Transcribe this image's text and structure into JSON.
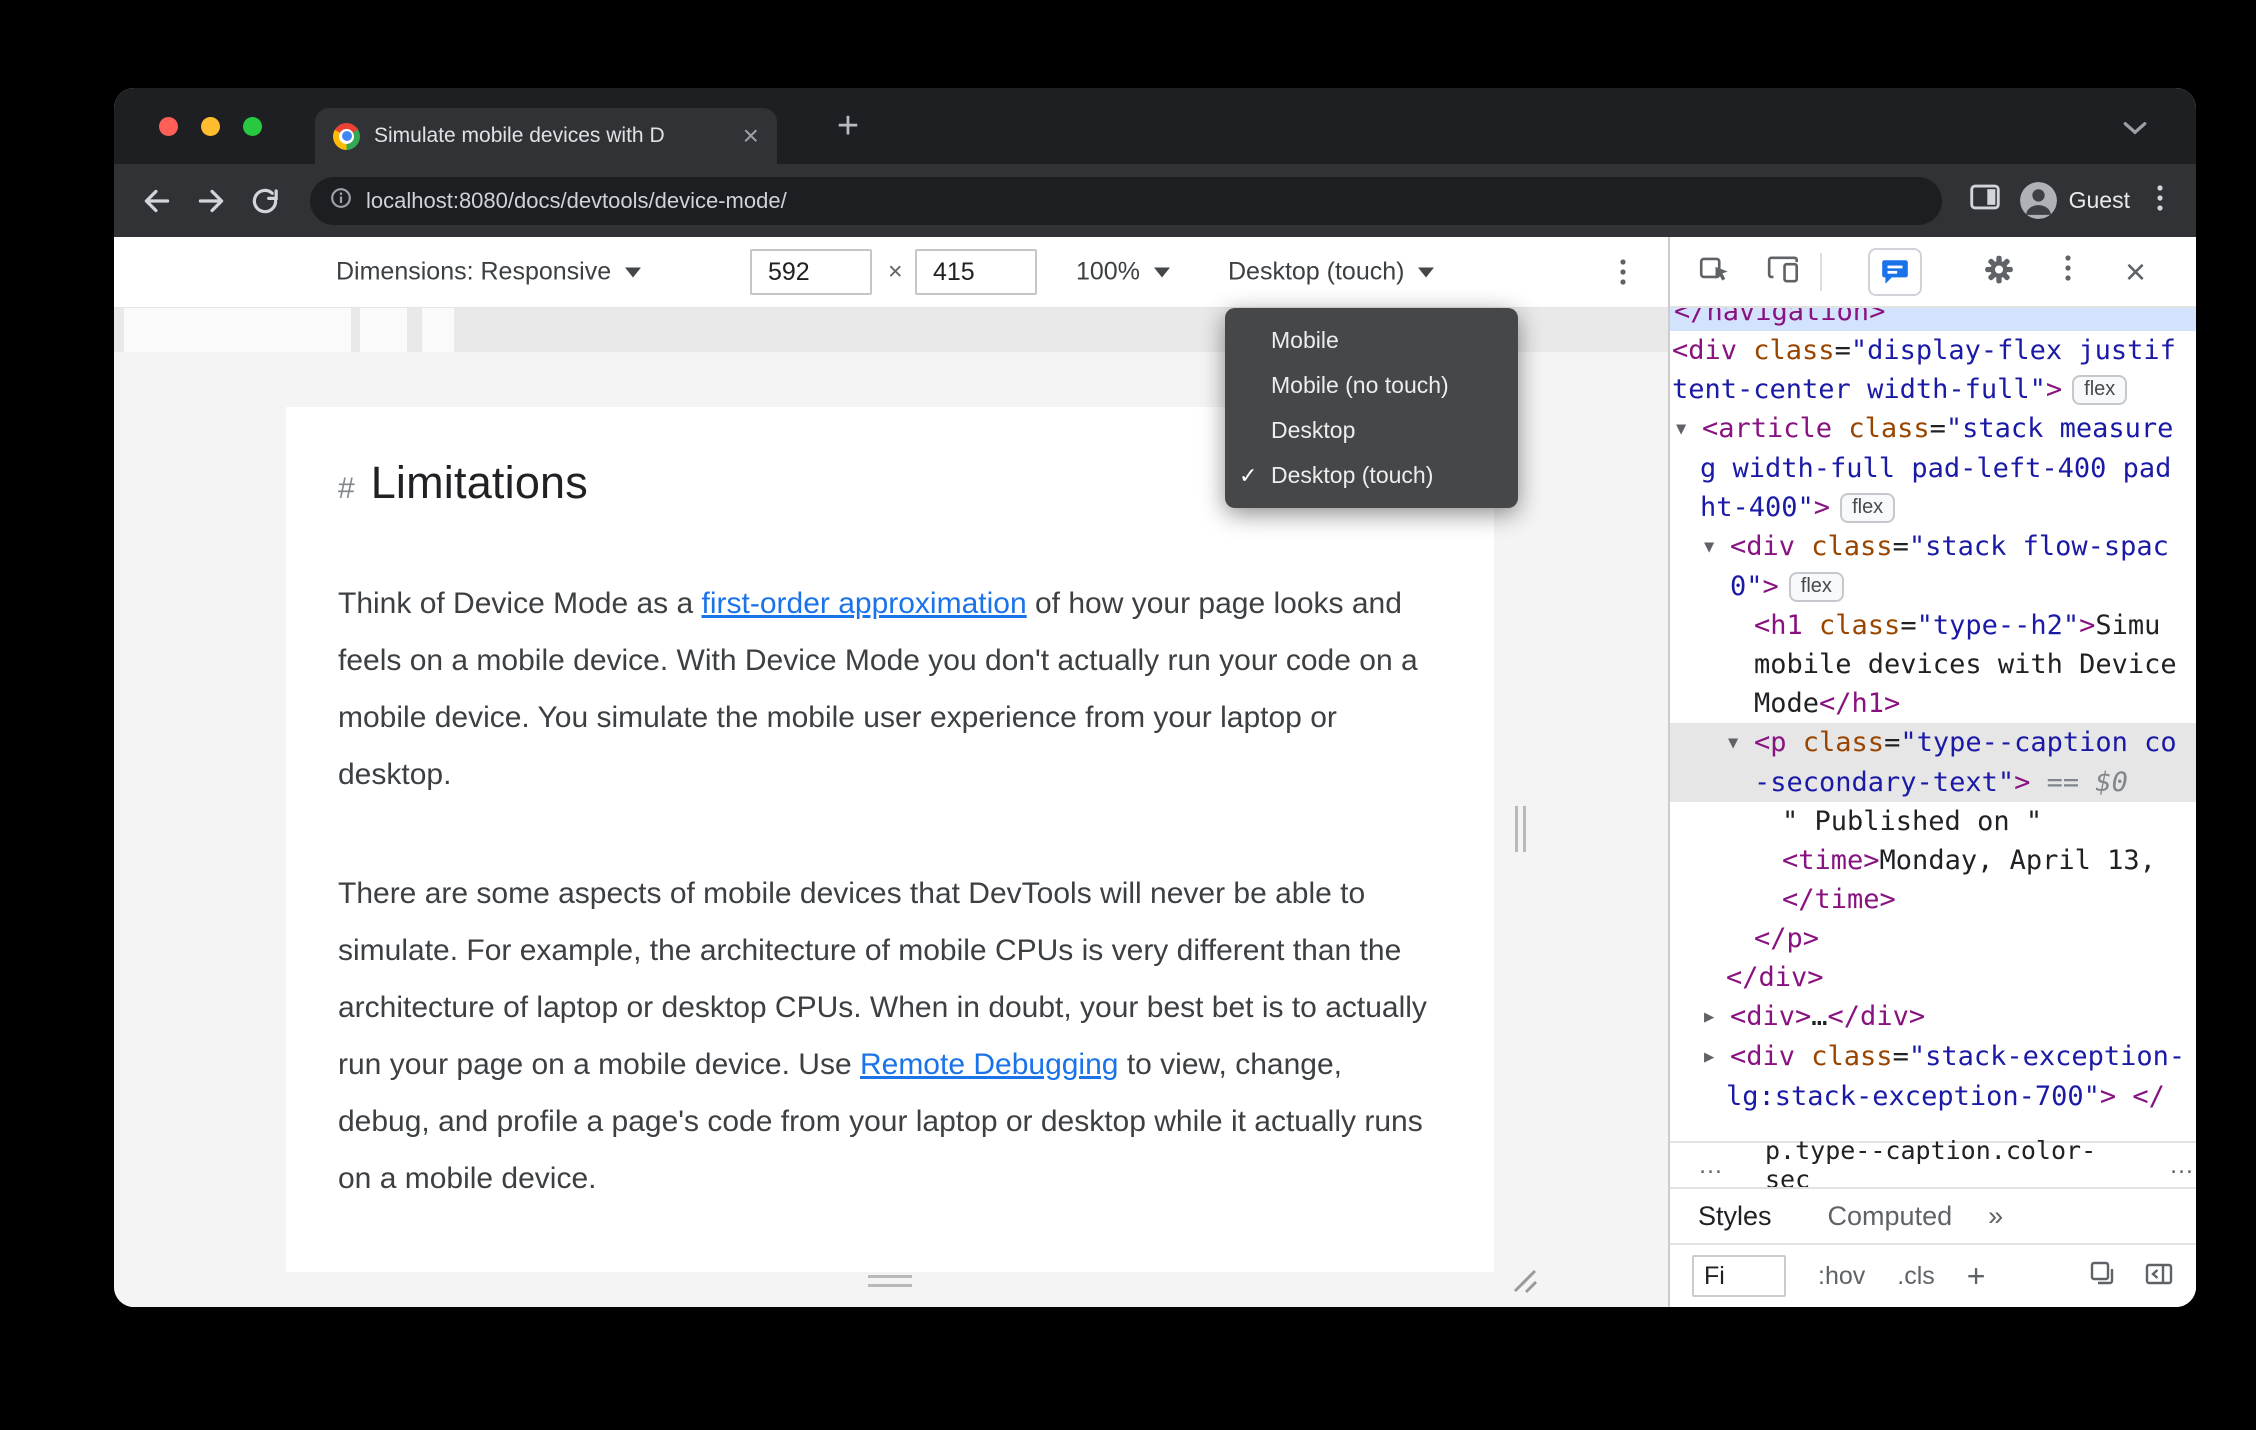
{
  "chrome": {
    "tab_title": "Simulate mobile devices with D",
    "tab_close": "×",
    "new_tab": "+",
    "url": "localhost:8080/docs/devtools/device-mode/",
    "guest": "Guest"
  },
  "device_toolbar": {
    "dimensions": "Dimensions: Responsive",
    "width": "592",
    "times": "×",
    "height": "415",
    "zoom": "100%",
    "device": "Desktop (touch)"
  },
  "device_menu": {
    "check": "✓",
    "items": [
      {
        "label": "Mobile",
        "checked": false
      },
      {
        "label": "Mobile (no touch)",
        "checked": false
      },
      {
        "label": "Desktop",
        "checked": false
      },
      {
        "label": "Desktop (touch)",
        "checked": true
      }
    ]
  },
  "page": {
    "hash": "#",
    "heading": "Limitations",
    "p1_before": "Think of Device Mode as a ",
    "p1_link": "first-order approximation",
    "p1_after": " of how your page looks and feels on a mobile device. With Device Mode you don't actually run your code on a mobile device. You simulate the mobile user experience from your laptop or desktop.",
    "p2_before": "There are some aspects of mobile devices that DevTools will never be able to simulate. For example, the architecture of mobile CPUs is very different than the architecture of laptop or desktop CPUs. When in doubt, your best bet is to actually run your page on a mobile device. Use ",
    "p2_link": "Remote Debugging",
    "p2_after": " to view, change, debug, and profile a page's code from your laptop or desktop while it actually runs on a mobile device."
  },
  "devtools": {
    "tree": [
      {
        "ind": 4,
        "hl": "blue",
        "segs": [
          {
            "t": "</navigation>",
            "c": "tag"
          }
        ]
      },
      {
        "ind": 2,
        "segs": [
          {
            "t": "<div ",
            "c": "tag"
          },
          {
            "t": "class",
            "c": "attr"
          },
          {
            "t": "=",
            "c": "plain"
          },
          {
            "t": "\"display-flex justif",
            "c": "val"
          }
        ]
      },
      {
        "ind": 2,
        "segs": [
          {
            "t": "tent-center width-full\"",
            "c": "val"
          },
          {
            "t": ">",
            "c": "tag"
          },
          {
            "t": "flex",
            "c": "badge"
          }
        ]
      },
      {
        "ind": 6,
        "segs": [
          {
            "t": "▼",
            "c": "arrow"
          },
          {
            "t": "<article ",
            "c": "tag"
          },
          {
            "t": "class",
            "c": "attr"
          },
          {
            "t": "=",
            "c": "plain"
          },
          {
            "t": "\"stack measure",
            "c": "val"
          }
        ]
      },
      {
        "ind": 30,
        "segs": [
          {
            "t": "g width-full pad-left-400 pad",
            "c": "val"
          }
        ]
      },
      {
        "ind": 30,
        "segs": [
          {
            "t": "ht-400\"",
            "c": "val"
          },
          {
            "t": ">",
            "c": "tag"
          },
          {
            "t": "flex",
            "c": "badge"
          }
        ]
      },
      {
        "ind": 34,
        "segs": [
          {
            "t": "▼",
            "c": "arrow"
          },
          {
            "t": "<div ",
            "c": "tag"
          },
          {
            "t": "class",
            "c": "attr"
          },
          {
            "t": "=",
            "c": "plain"
          },
          {
            "t": "\"stack flow-spac",
            "c": "val"
          }
        ]
      },
      {
        "ind": 60,
        "segs": [
          {
            "t": "0\"",
            "c": "val"
          },
          {
            "t": ">",
            "c": "tag"
          },
          {
            "t": "flex",
            "c": "badge"
          }
        ]
      },
      {
        "ind": 84,
        "segs": [
          {
            "t": "<h1 ",
            "c": "tag"
          },
          {
            "t": "class",
            "c": "attr"
          },
          {
            "t": "=",
            "c": "plain"
          },
          {
            "t": "\"type--h2\"",
            "c": "val"
          },
          {
            "t": ">",
            "c": "tag"
          },
          {
            "t": "Simu",
            "c": "text"
          }
        ]
      },
      {
        "ind": 84,
        "segs": [
          {
            "t": "mobile devices with Device",
            "c": "text"
          }
        ]
      },
      {
        "ind": 84,
        "segs": [
          {
            "t": "Mode",
            "c": "text"
          },
          {
            "t": "</h1>",
            "c": "tag"
          }
        ]
      },
      {
        "ind": 58,
        "hl": "gray",
        "segs": [
          {
            "t": "▼",
            "c": "arrow"
          },
          {
            "t": "<p ",
            "c": "tag"
          },
          {
            "t": "class",
            "c": "attr"
          },
          {
            "t": "=",
            "c": "plain"
          },
          {
            "t": "\"type--caption co",
            "c": "val"
          }
        ]
      },
      {
        "ind": 84,
        "hl": "gray",
        "segs": [
          {
            "t": "-secondary-text\"",
            "c": "val"
          },
          {
            "t": ">",
            "c": "tag"
          },
          {
            "t": " == ",
            "c": "meta"
          },
          {
            "t": "$0",
            "c": "meta"
          }
        ]
      },
      {
        "ind": 112,
        "segs": [
          {
            "t": "\" Published on \"",
            "c": "text"
          }
        ]
      },
      {
        "ind": 112,
        "segs": [
          {
            "t": "<time>",
            "c": "tag"
          },
          {
            "t": "Monday, April 13,",
            "c": "text"
          }
        ]
      },
      {
        "ind": 112,
        "segs": [
          {
            "t": "</time>",
            "c": "tag"
          }
        ]
      },
      {
        "ind": 84,
        "segs": [
          {
            "t": "</p>",
            "c": "tag"
          }
        ]
      },
      {
        "ind": 56,
        "segs": [
          {
            "t": "</div>",
            "c": "tag"
          }
        ]
      },
      {
        "ind": 34,
        "segs": [
          {
            "t": "▶",
            "c": "arrow"
          },
          {
            "t": "<div>",
            "c": "tag"
          },
          {
            "t": "…",
            "c": "text"
          },
          {
            "t": "</div>",
            "c": "tag"
          }
        ]
      },
      {
        "ind": 34,
        "segs": [
          {
            "t": "▶",
            "c": "arrow"
          },
          {
            "t": "<div ",
            "c": "tag"
          },
          {
            "t": "class",
            "c": "attr"
          },
          {
            "t": "=",
            "c": "plain"
          },
          {
            "t": "\"stack-exception-",
            "c": "val"
          }
        ]
      },
      {
        "ind": 56,
        "segs": [
          {
            "t": "lg:stack-exception-700\"",
            "c": "val"
          },
          {
            "t": ">",
            "c": "tag"
          },
          {
            "t": " </",
            "c": "tag"
          }
        ]
      }
    ],
    "breadcrumb": {
      "left_more": "…",
      "selected": "p.type--caption.color-sec",
      "right_more": "…"
    },
    "tabs": {
      "styles": "Styles",
      "computed": "Computed",
      "more": "»"
    },
    "filter": {
      "value": "Fi",
      "hov": ":hov",
      "cls": ".cls",
      "plus": "+"
    }
  }
}
